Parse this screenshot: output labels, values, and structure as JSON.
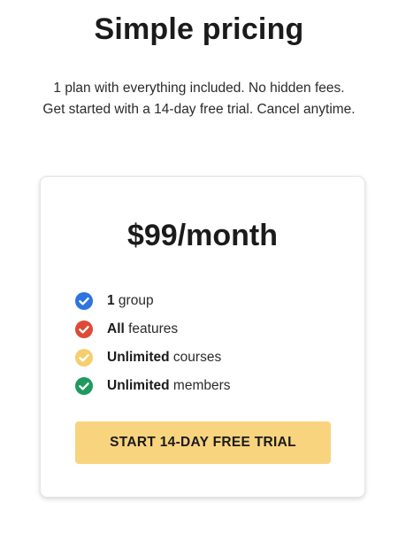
{
  "header": {
    "title": "Simple pricing",
    "subtitle_line1": "1 plan with everything included. No hidden fees.",
    "subtitle_line2": "Get started with a 14-day free trial. Cancel anytime."
  },
  "plan": {
    "price": "$99/month",
    "features": [
      {
        "bold": "1",
        "text": " group",
        "icon": "check-circle-icon",
        "color": "#2f73e0"
      },
      {
        "bold": "All",
        "text": " features",
        "icon": "check-circle-icon",
        "color": "#dd4a36"
      },
      {
        "bold": "Unlimited",
        "text": " courses",
        "icon": "check-circle-icon",
        "color": "#f7ce6e"
      },
      {
        "bold": "Unlimited",
        "text": " members",
        "icon": "check-circle-icon",
        "color": "#1e9a5c"
      }
    ],
    "cta_label": "START 14-DAY FREE TRIAL",
    "cta_color": "#f8d47e"
  }
}
